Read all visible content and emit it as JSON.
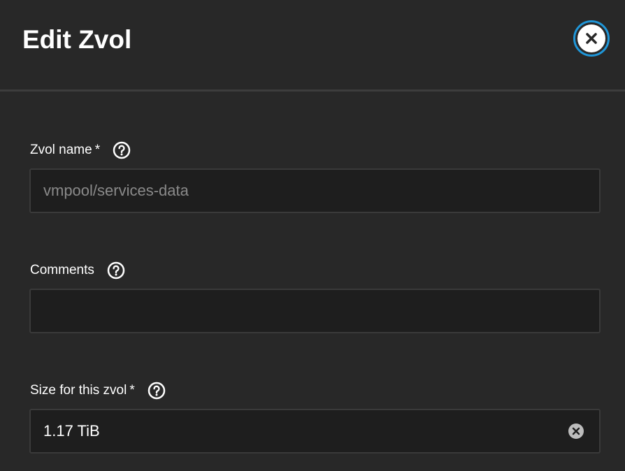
{
  "dialog": {
    "title": "Edit Zvol",
    "close_icon": "close-circle-icon",
    "accent_color": "#1f96d8"
  },
  "fields": {
    "name": {
      "label": "Zvol name",
      "required_mark": "*",
      "value": "vmpool/services-data",
      "disabled": true,
      "help_icon": "help-circle-icon"
    },
    "comments": {
      "label": "Comments",
      "value": "",
      "help_icon": "help-circle-icon"
    },
    "size": {
      "label": "Size for this zvol",
      "required_mark": "*",
      "value": "1.17 TiB",
      "help_icon": "help-circle-icon",
      "clear_icon": "clear-icon"
    }
  }
}
